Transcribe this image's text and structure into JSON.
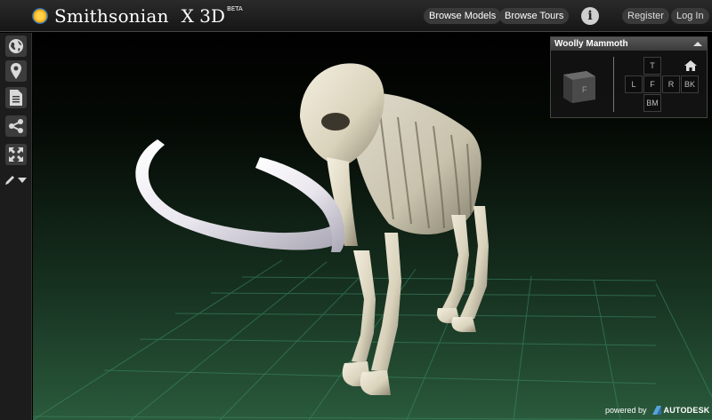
{
  "brand": {
    "name": "Smithsonian",
    "product": "X 3D",
    "beta": "BETA"
  },
  "nav": {
    "browse_models": "Browse Models",
    "browse_tours": "Browse Tours",
    "info": "i",
    "register": "Register",
    "login": "Log In"
  },
  "toolbar": {
    "items": [
      {
        "icon": "globe-icon",
        "label": ""
      },
      {
        "icon": "map-pin-icon",
        "label": ""
      },
      {
        "icon": "document-icon",
        "label": ""
      },
      {
        "icon": "share-icon",
        "label": ""
      },
      {
        "icon": "fullscreen-icon",
        "label": ""
      },
      {
        "icon": "pencil-dropdown-icon",
        "label": ""
      }
    ]
  },
  "model": {
    "name": "Woolly Mammoth"
  },
  "viewcube": {
    "face_label": "F",
    "buttons": {
      "top": "T",
      "left": "L",
      "front": "F",
      "right": "R",
      "back": "BK",
      "bottom": "BM"
    }
  },
  "footer": {
    "powered_by": "powered by",
    "vendor": "AUTODESK"
  },
  "colors": {
    "accent_sun": "#ffd24a",
    "grid": "#3f8f6a",
    "bone": "#e8e2cf"
  }
}
